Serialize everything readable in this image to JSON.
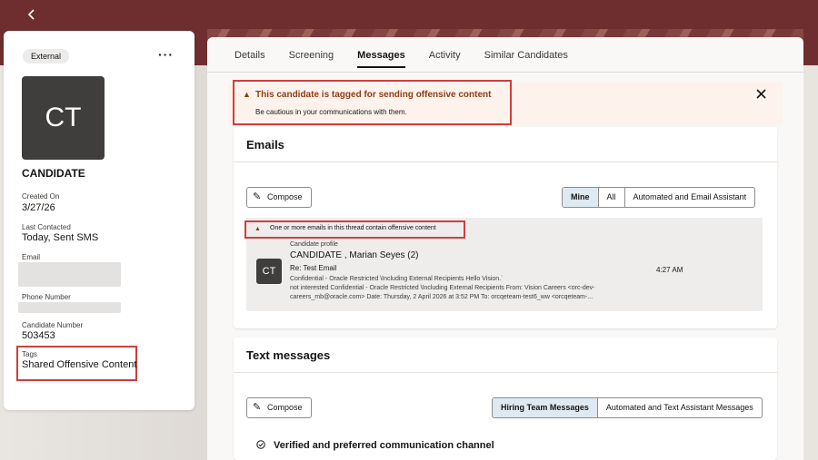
{
  "colors": {
    "banner": "#6e2e30",
    "alert_text": "#8f3c14",
    "highlight_frame": "#d23d3d",
    "selected_segment": "#dfe9f1"
  },
  "nav": {
    "back_icon": "chevron-left-icon"
  },
  "profile": {
    "chip": "External",
    "more_icon": "more-horizontal-icon",
    "initials": "CT",
    "name": "CANDIDATE",
    "created_label": "Created On",
    "created_value": "3/27/26",
    "last_contacted_label": "Last Contacted",
    "last_contacted_value": "Today, Sent SMS",
    "email_label": "Email",
    "phone_label": "Phone Number",
    "candidate_number_label": "Candidate Number",
    "candidate_number_value": "503453",
    "tags_label": "Tags",
    "tags_value": "Shared Offensive Content"
  },
  "tabs": [
    {
      "label": "Details",
      "active": false
    },
    {
      "label": "Screening",
      "active": false
    },
    {
      "label": "Messages",
      "active": true
    },
    {
      "label": "Activity",
      "active": false
    },
    {
      "label": "Similar Candidates",
      "active": false
    }
  ],
  "alert": {
    "icon": "warning-icon",
    "title": "This candidate is tagged for sending offensive content",
    "subtitle": "Be cautious in your communications with them.",
    "close_icon": "close-icon"
  },
  "emails": {
    "title": "Emails",
    "compose_label": "Compose",
    "filters": [
      "Mine",
      "All",
      "Automated and Email Assistant"
    ],
    "selected_filter": "Mine",
    "thread": {
      "warning": "One or more emails in this thread contain offensive content",
      "initials": "CT",
      "source": "Candidate profile",
      "name": "CANDIDATE , Marian Seyes (2)",
      "subject": "Re: Test Email",
      "preview_line1": "Confidential - Oracle Restricted \\Including External Recipients Hello Vision.`",
      "preview_line2": "not interested Confidential - Oracle Restricted \\Including External Recipients From: Vision Careers <orc-dev-",
      "preview_line3": "careers_mb@oracle.com> Date: Thursday, 2 April 2026 at 3:52 PM To: orcqeteam-test6_ww <orcqeteam-...",
      "time": "4:27 AM"
    }
  },
  "text_messages": {
    "title": "Text messages",
    "compose_label": "Compose",
    "filters": [
      "Hiring Team Messages",
      "Automated and Text Assistant Messages"
    ],
    "selected_filter": "Hiring Team Messages",
    "verified_label": "Verified and preferred communication channel"
  }
}
